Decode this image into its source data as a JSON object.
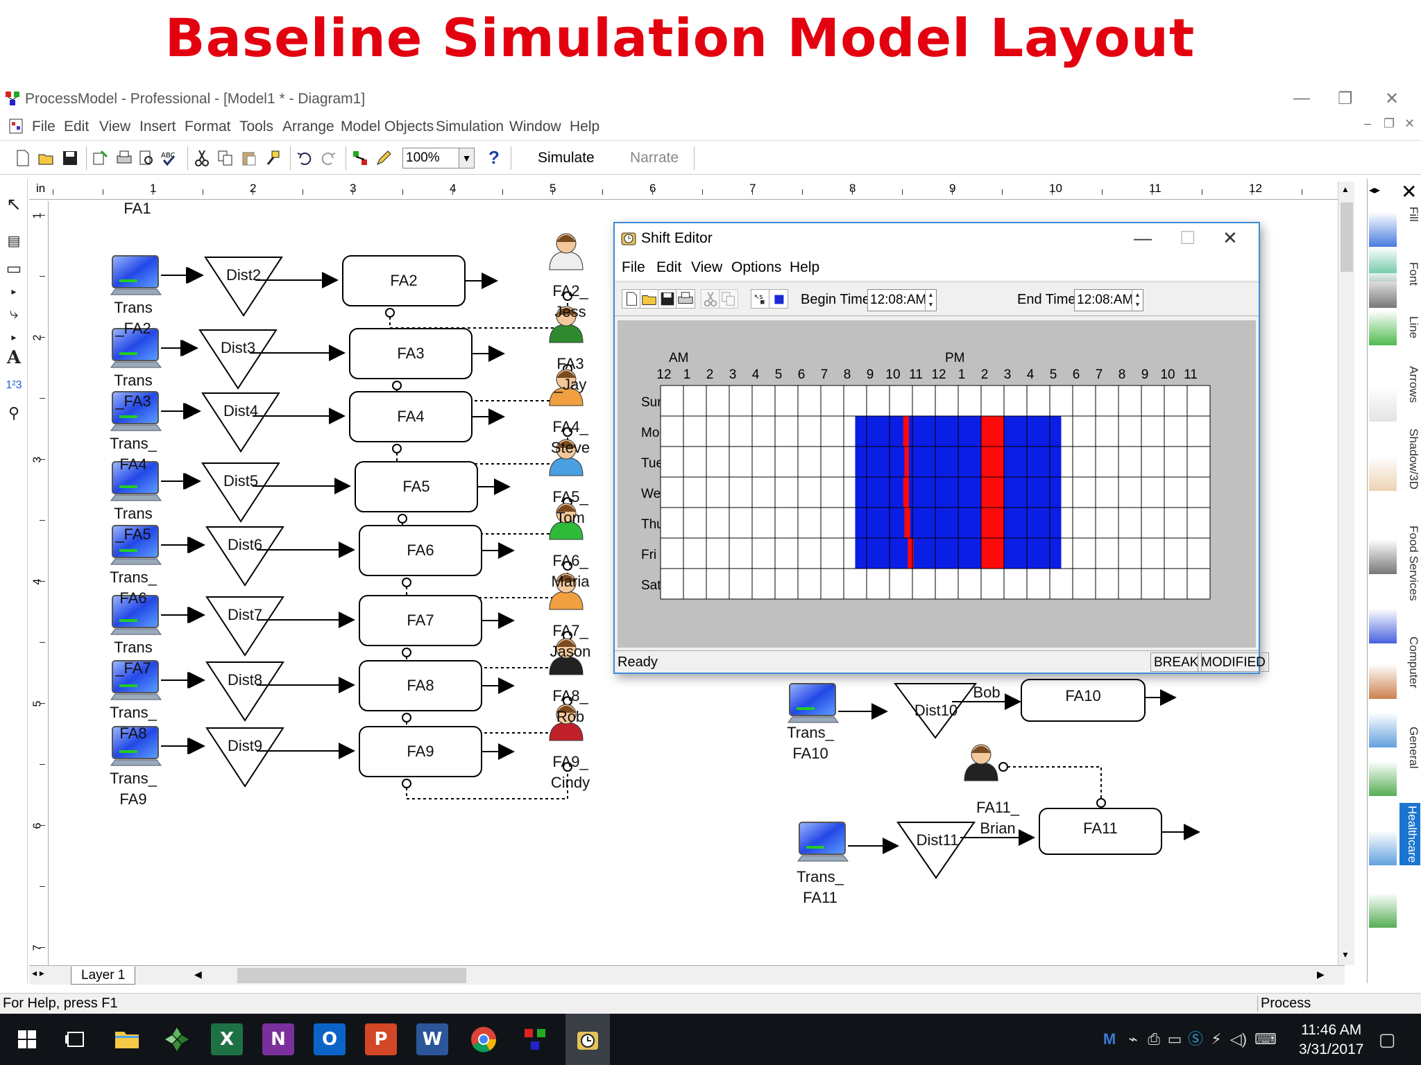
{
  "slide_title": "Baseline Simulation Model Layout",
  "window": {
    "title": "ProcessModel - Professional - [Model1 * - Diagram1]"
  },
  "menu": [
    "File",
    "Edit",
    "View",
    "Insert",
    "Format",
    "Tools",
    "Arrange",
    "Model Objects",
    "Simulation",
    "Window",
    "Help"
  ],
  "toolbar": {
    "zoom_value": "100%",
    "help_label": "?",
    "simulate_label": "Simulate",
    "narrate_label": "Narrate"
  },
  "ruler": {
    "unit": "in",
    "h_marks": [
      "1",
      "2",
      "3",
      "4",
      "5",
      "6",
      "7",
      "8",
      "9",
      "10",
      "11",
      "12"
    ],
    "v_marks": [
      "1",
      "2",
      "3",
      "4",
      "5",
      "6",
      "7"
    ]
  },
  "diagram": {
    "top_label": "FA1",
    "rows": [
      {
        "trans": "Trans\n_FA2",
        "dist": "Dist2",
        "activity": "FA2",
        "resource": "FA2_\nJess"
      },
      {
        "trans": "Trans\n_FA3",
        "dist": "Dist3",
        "activity": "FA3",
        "resource": "FA3\n_Jay"
      },
      {
        "trans": "Trans_\nFA4",
        "dist": "Dist4",
        "activity": "FA4",
        "resource": "FA4_\nSteve"
      },
      {
        "trans": "Trans\n_FA5",
        "dist": "Dist5",
        "activity": "FA5",
        "resource": "FA5_\nTom"
      },
      {
        "trans": "Trans_\nFA6",
        "dist": "Dist6",
        "activity": "FA6",
        "resource": "FA6_\nMaria"
      },
      {
        "trans": "Trans\n_FA7",
        "dist": "Dist7",
        "activity": "FA7",
        "resource": "FA7_\nJason"
      },
      {
        "trans": "Trans_\nFA8",
        "dist": "Dist8",
        "activity": "FA8",
        "resource": "FA8_\nRob"
      },
      {
        "trans": "Trans_\nFA9",
        "dist": "Dist9",
        "activity": "FA9",
        "resource": "FA9_\nCindy"
      }
    ],
    "right_rows": [
      {
        "trans": "Trans_\nFA10",
        "dist": "Dist10",
        "activity": "FA10",
        "resource": "Bob"
      },
      {
        "trans": "Trans_\nFA11",
        "dist": "Dist11",
        "activity": "FA11",
        "resource": "FA11_\nBrian"
      }
    ]
  },
  "library_tabs": [
    "Fill",
    "Font",
    "Line",
    "Arrows",
    "Shadow/3D",
    "Food Services",
    "Computer",
    "General",
    "Healthcare"
  ],
  "active_library_tab": "Healthcare",
  "bottom": {
    "layer_tab": "Layer 1"
  },
  "status": {
    "help": "For Help, press F1",
    "mode": "Process"
  },
  "taskbar": {
    "time": "11:46 AM",
    "date": "3/31/2017",
    "apps": [
      "start",
      "task-view",
      "file-explorer",
      "processmodel-launcher",
      "excel",
      "onenote",
      "outlook",
      "powerpoint",
      "word",
      "chrome",
      "processmodel",
      "shift-editor"
    ]
  },
  "shift_editor": {
    "title": "Shift Editor",
    "menu": [
      "File",
      "Edit",
      "View",
      "Options",
      "Help"
    ],
    "begin_time_label": "Begin Time",
    "begin_time_value": "12:08:AM",
    "end_time_label": "End Time",
    "end_time_value": "12:08:AM",
    "am_label": "AM",
    "pm_label": "PM",
    "hours": [
      "12",
      "1",
      "2",
      "3",
      "4",
      "5",
      "6",
      "7",
      "8",
      "9",
      "10",
      "11",
      "12",
      "1",
      "2",
      "3",
      "4",
      "5",
      "6",
      "7",
      "8",
      "9",
      "10",
      "11"
    ],
    "days": [
      "Sun",
      "Mon",
      "Tue",
      "Wed",
      "Thu",
      "Fri",
      "Sat"
    ],
    "shift": {
      "work_days": [
        "Mon",
        "Tue",
        "Wed",
        "Thu",
        "Fri"
      ],
      "start_hour": 8.5,
      "end_hour": 17.5,
      "breaks": [
        {
          "day": "Mon",
          "start": 10.6,
          "end": 10.85
        },
        {
          "day": "Tue",
          "start": 10.65,
          "end": 10.85
        },
        {
          "day": "Wed",
          "start": 10.6,
          "end": 10.85
        },
        {
          "day": "Thu",
          "start": 10.65,
          "end": 10.9
        },
        {
          "day": "Fri",
          "start": 10.8,
          "end": 11.05
        },
        {
          "day": "Mon",
          "start": 14.0,
          "end": 15.0
        },
        {
          "day": "Tue",
          "start": 14.0,
          "end": 15.0
        },
        {
          "day": "Wed",
          "start": 14.0,
          "end": 15.0
        },
        {
          "day": "Thu",
          "start": 14.0,
          "end": 15.0
        },
        {
          "day": "Fri",
          "start": 14.0,
          "end": 15.0
        }
      ]
    },
    "colors": {
      "work": "#0a1ee6",
      "break": "#ff0a0a"
    },
    "status": "Ready",
    "status_panes": [
      "BREAK",
      "MODIFIED"
    ]
  }
}
